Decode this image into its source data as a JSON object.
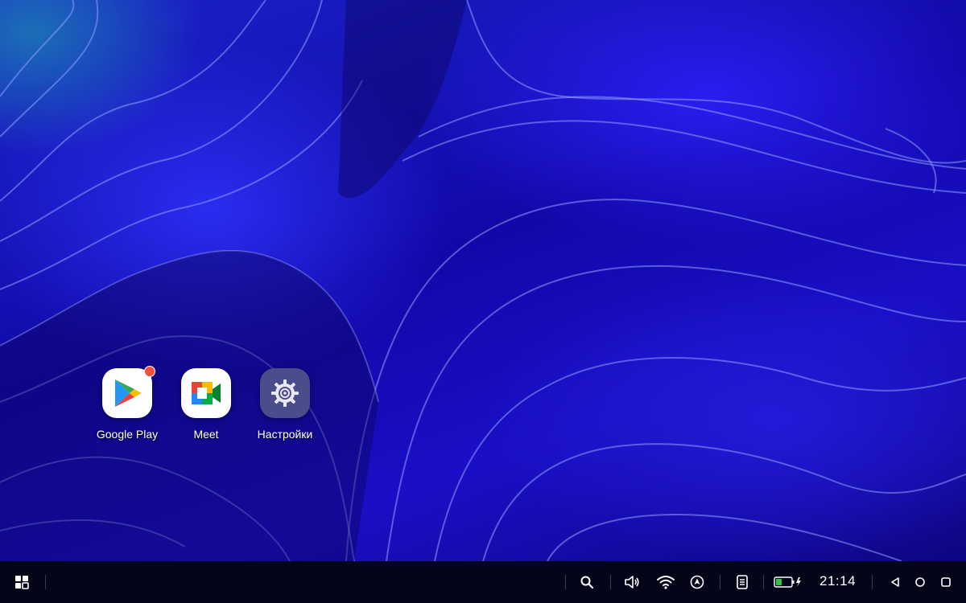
{
  "desktop": {
    "apps": [
      {
        "label": "Google Play",
        "icon": "google-play-icon",
        "badge": true
      },
      {
        "label": "Meet",
        "icon": "google-meet-icon",
        "badge": false
      },
      {
        "label": "Настройки",
        "icon": "settings-gear-icon",
        "badge": false
      }
    ]
  },
  "taskbar": {
    "start_icon": "app-grid-icon",
    "tray_icons": [
      "search-icon",
      "volume-icon",
      "wifi-icon",
      "navigation-icon",
      "notes-icon",
      "battery-charging-icon"
    ],
    "clock": "21:14",
    "nav_icons": [
      "back-icon",
      "home-icon",
      "recents-icon"
    ]
  },
  "colors": {
    "wallpaper": "#1a10b8",
    "taskbar": "#05051a",
    "badge": "#f0503c",
    "battery_fill": "#35c24a"
  }
}
